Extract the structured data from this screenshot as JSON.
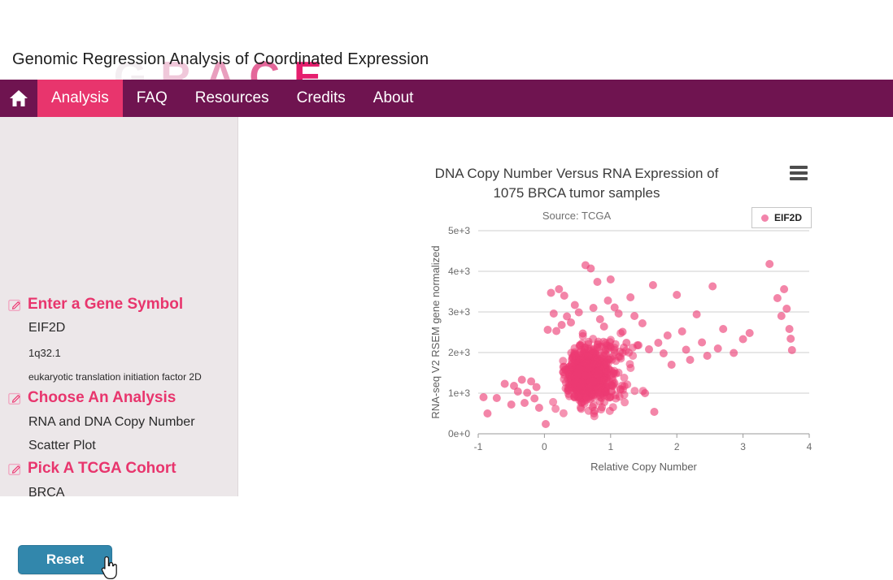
{
  "brand": {
    "logo_text": "GRACE",
    "logo_letters": [
      "G",
      "R",
      "A",
      "C",
      "E"
    ],
    "tagline": "Genomic Regression Analysis of Coordinated Expression",
    "accent_pink": "#e8356d",
    "nav_purple": "#6f1450",
    "sidebar_bg": "#ece7e9",
    "reset_blue": "#3287ac",
    "point_pink": "#ec3a73"
  },
  "nav": {
    "home_icon": "home-icon",
    "items": [
      {
        "label": "Analysis",
        "active": true
      },
      {
        "label": "FAQ",
        "active": false
      },
      {
        "label": "Resources",
        "active": false
      },
      {
        "label": "Credits",
        "active": false
      },
      {
        "label": "About",
        "active": false
      }
    ]
  },
  "sidebar": {
    "sections": [
      {
        "heading": "Enter a Gene Symbol",
        "icon": "edit-pencil-icon",
        "values": [
          "EIF2D",
          "1q32.1",
          "eukaryotic translation initiation factor 2D"
        ]
      },
      {
        "heading": "Choose An Analysis",
        "icon": "edit-pencil-icon",
        "values": [
          "RNA and DNA Copy Number",
          "Scatter Plot"
        ]
      },
      {
        "heading": "Pick A TCGA Cohort",
        "icon": "edit-pencil-icon",
        "values": [
          "BRCA"
        ]
      }
    ],
    "reset_label": "Reset"
  },
  "chart_panel": {
    "menu_icon": "hamburger-menu-icon",
    "legend": {
      "label": "EIF2D",
      "marker_color": "#f284ab"
    }
  },
  "chart_data": {
    "type": "scatter",
    "title": "DNA Copy Number Versus RNA Expression of 1075 BRCA tumor samples",
    "title_line1": "DNA Copy Number Versus RNA Expression of",
    "title_line2": "1075 BRCA tumor samples",
    "subtitle": "Source: TCGA",
    "xlabel": "Relative Copy Number",
    "ylabel": "RNA-seq V2 RSEM gene normalized",
    "xlim": [
      -1,
      4
    ],
    "ylim": [
      0,
      5000
    ],
    "xticks": [
      -1,
      0,
      1,
      2,
      3,
      4
    ],
    "xticklabels": [
      "-1",
      "0",
      "1",
      "2",
      "3",
      "4"
    ],
    "yticks": [
      0,
      1000,
      2000,
      3000,
      4000,
      5000
    ],
    "yticklabels": [
      "0e+0",
      "1e+3",
      "2e+3",
      "3e+3",
      "4e+3",
      "5e+3"
    ],
    "grid": true,
    "legend_position": "top-right",
    "n_samples": 1075,
    "series": [
      {
        "name": "EIF2D",
        "color": "#ec3a73",
        "marker_radius": 5,
        "opacity": 0.55,
        "cluster": {
          "n": 900,
          "x_mean": 0.45,
          "x_sd": 0.3,
          "x_min": 0.0,
          "x_max": 1.6,
          "y_mean": 1450,
          "y_sd": 330,
          "y_min": 350,
          "y_max": 2600,
          "correlation": 0.55
        },
        "outliers": [
          [
            -0.92,
            900
          ],
          [
            -0.86,
            500
          ],
          [
            -0.72,
            880
          ],
          [
            -0.6,
            1230
          ],
          [
            -0.5,
            720
          ],
          [
            -0.46,
            1180
          ],
          [
            -0.4,
            1040
          ],
          [
            -0.34,
            1330
          ],
          [
            -0.3,
            760
          ],
          [
            -0.26,
            1010
          ],
          [
            -0.2,
            1290
          ],
          [
            -0.15,
            870
          ],
          [
            -0.12,
            1150
          ],
          [
            -0.08,
            640
          ],
          [
            0.02,
            240
          ],
          [
            0.05,
            2560
          ],
          [
            0.1,
            3470
          ],
          [
            0.14,
            2960
          ],
          [
            0.18,
            2530
          ],
          [
            0.22,
            3560
          ],
          [
            0.26,
            2680
          ],
          [
            0.3,
            3400
          ],
          [
            0.34,
            2890
          ],
          [
            0.4,
            2740
          ],
          [
            0.46,
            3170
          ],
          [
            0.52,
            2990
          ],
          [
            0.58,
            2470
          ],
          [
            0.62,
            4150
          ],
          [
            0.7,
            4070
          ],
          [
            0.74,
            3100
          ],
          [
            0.8,
            3740
          ],
          [
            0.84,
            2820
          ],
          [
            0.9,
            2640
          ],
          [
            0.96,
            3280
          ],
          [
            1.0,
            3800
          ],
          [
            1.06,
            3110
          ],
          [
            1.12,
            2960
          ],
          [
            1.18,
            2510
          ],
          [
            1.24,
            2240
          ],
          [
            1.3,
            3360
          ],
          [
            1.36,
            2900
          ],
          [
            1.42,
            2180
          ],
          [
            1.48,
            2720
          ],
          [
            1.52,
            1000
          ],
          [
            1.58,
            2080
          ],
          [
            1.64,
            3660
          ],
          [
            1.66,
            540
          ],
          [
            1.72,
            2240
          ],
          [
            1.8,
            1980
          ],
          [
            1.86,
            2420
          ],
          [
            1.92,
            1700
          ],
          [
            2.0,
            3420
          ],
          [
            2.08,
            2520
          ],
          [
            2.14,
            2070
          ],
          [
            2.2,
            1820
          ],
          [
            2.3,
            2940
          ],
          [
            2.38,
            2250
          ],
          [
            2.46,
            1920
          ],
          [
            2.54,
            3630
          ],
          [
            2.62,
            2100
          ],
          [
            2.7,
            2580
          ],
          [
            2.86,
            1990
          ],
          [
            3.0,
            2330
          ],
          [
            3.1,
            2480
          ],
          [
            3.4,
            4180
          ],
          [
            3.52,
            3340
          ],
          [
            3.58,
            2900
          ],
          [
            3.62,
            3560
          ],
          [
            3.66,
            3080
          ],
          [
            3.7,
            2580
          ],
          [
            3.72,
            2340
          ],
          [
            3.74,
            2060
          ]
        ]
      }
    ]
  }
}
